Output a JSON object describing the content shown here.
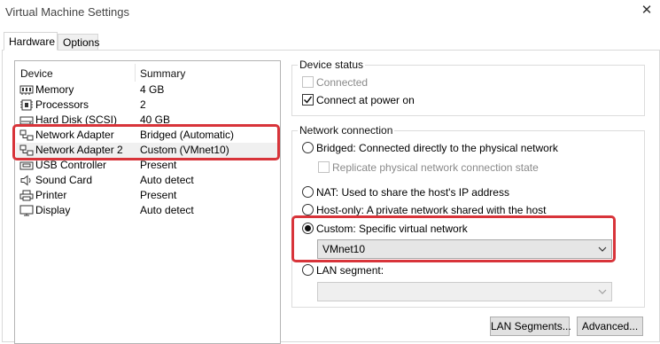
{
  "window": {
    "title": "Virtual Machine Settings"
  },
  "tabs": [
    {
      "label": "Hardware",
      "active": true
    },
    {
      "label": "Options",
      "active": false
    }
  ],
  "device_list": {
    "columns": [
      "Device",
      "Summary"
    ],
    "rows": [
      {
        "name": "Memory",
        "summary": "4 GB",
        "icon": "memory-icon"
      },
      {
        "name": "Processors",
        "summary": "2",
        "icon": "processor-icon"
      },
      {
        "name": "Hard Disk (SCSI)",
        "summary": "40 GB",
        "icon": "hard-disk-icon"
      },
      {
        "name": "Network Adapter",
        "summary": "Bridged (Automatic)",
        "icon": "network-adapter-icon"
      },
      {
        "name": "Network Adapter 2",
        "summary": "Custom (VMnet10)",
        "icon": "network-adapter-icon",
        "selected": true
      },
      {
        "name": "USB Controller",
        "summary": "Present",
        "icon": "usb-controller-icon"
      },
      {
        "name": "Sound Card",
        "summary": "Auto detect",
        "icon": "sound-card-icon"
      },
      {
        "name": "Printer",
        "summary": "Present",
        "icon": "printer-icon"
      },
      {
        "name": "Display",
        "summary": "Auto detect",
        "icon": "display-icon"
      }
    ]
  },
  "device_status": {
    "title": "Device status",
    "connected": {
      "label": "Connected",
      "checked": false,
      "enabled": false
    },
    "connect_at_power_on": {
      "label": "Connect at power on",
      "checked": true,
      "enabled": true
    }
  },
  "network_connection": {
    "title": "Network connection",
    "bridged": {
      "label": "Bridged: Connected directly to the physical network",
      "selected": false
    },
    "replicate": {
      "label": "Replicate physical network connection state",
      "checked": false,
      "enabled": false
    },
    "nat": {
      "label": "NAT: Used to share the host's IP address",
      "selected": false
    },
    "host_only": {
      "label": "Host-only: A private network shared with the host",
      "selected": false
    },
    "custom": {
      "label": "Custom: Specific virtual network",
      "selected": true
    },
    "custom_network": {
      "value": "VMnet10"
    },
    "lan_segment": {
      "label": "LAN segment:",
      "selected": false,
      "value": ""
    }
  },
  "buttons": {
    "lan_segments": "LAN Segments...",
    "advanced": "Advanced..."
  },
  "colors": {
    "highlight": "#d8343a",
    "selected_row": "#f0f0f0"
  }
}
